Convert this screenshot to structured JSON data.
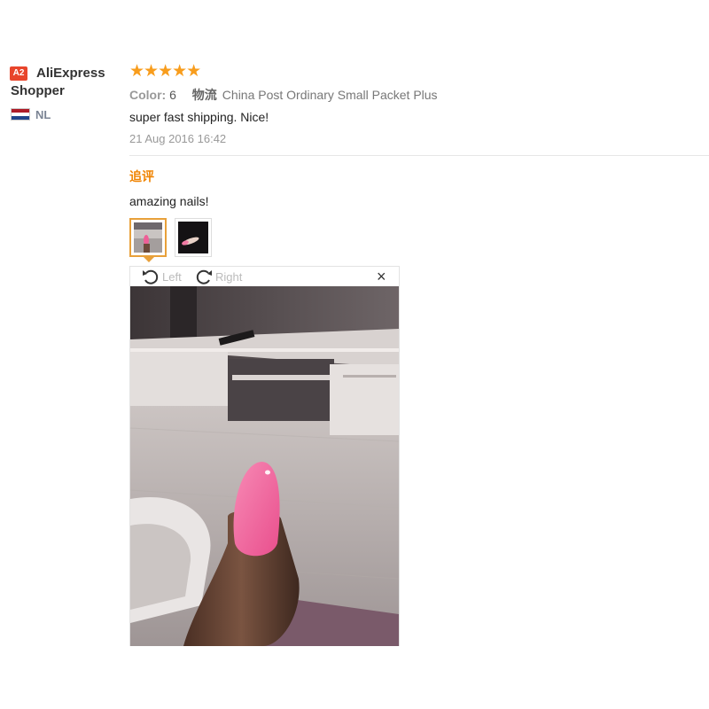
{
  "reviewer": {
    "badge": "A2",
    "name": "AliExpress Shopper",
    "country": "NL"
  },
  "review": {
    "rating": 5,
    "stars_text": "★★★★★",
    "color_label": "Color:",
    "color_value": "6",
    "logistics_label": "物流",
    "logistics_value": "China Post Ordinary Small Packet Plus",
    "text": "super fast shipping. Nice!",
    "date": "21 Aug 2016 16:42"
  },
  "followup": {
    "label": "追评",
    "text": "amazing nails!"
  },
  "viewer": {
    "rotate_left": "Left",
    "rotate_right": "Right",
    "close": "×"
  },
  "colors": {
    "star": "#f89d1d",
    "followup_label": "#f08300",
    "badge": "#e8452b",
    "thumb_active_border": "#e8a03a",
    "nail": "#f0629a"
  }
}
